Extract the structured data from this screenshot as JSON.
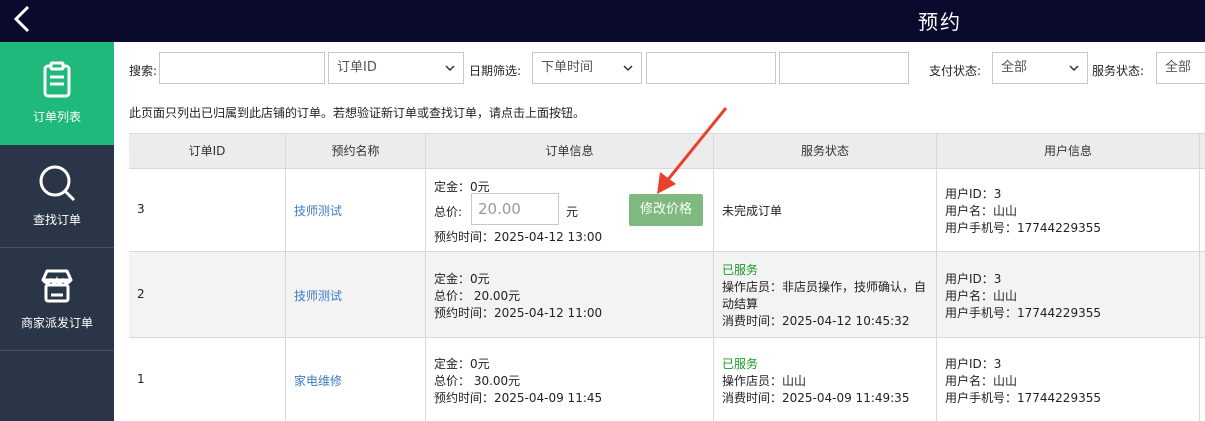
{
  "header": {
    "title": "预约",
    "back_icon": "chevron-left-icon"
  },
  "sidebar": {
    "items": [
      {
        "label": "订单列表",
        "icon": "clipboard-icon",
        "active": true
      },
      {
        "label": "查找订单",
        "icon": "search-icon",
        "active": false
      },
      {
        "label": "商家派发订单",
        "icon": "store-icon",
        "active": false
      }
    ],
    "active_color": "#1fba7b",
    "bg_color": "#2b3548"
  },
  "filters": {
    "search_label": "搜索:",
    "search_value": "",
    "id_select": "订单ID",
    "date_label": "日期筛选:",
    "date_select": "下单时间",
    "date_from": "",
    "date_to": "",
    "pay_label": "支付状态:",
    "pay_select": "全部",
    "service_label": "服务状态:",
    "service_select": "全部"
  },
  "notice": "此页面只列出已归属到此店铺的订单。若想验证新订单或查找订单，请点击上面按钮。",
  "table": {
    "headers": [
      "订单ID",
      "预约名称",
      "订单信息",
      "服务状态",
      "用户信息"
    ],
    "rows": [
      {
        "id": "3",
        "name": "技师测试",
        "deposit": "定金：0元",
        "total_label": "总价:",
        "total_input": "20.00",
        "total_unit": "元",
        "time": "预约时间：2025-04-12 13:00",
        "modify_button": "修改价格",
        "status": "未完成订单",
        "user_id": "用户ID：3",
        "user_name": "用户名：山山",
        "user_phone": "用户手机号：17744229355"
      },
      {
        "id": "2",
        "name": "技师测试",
        "deposit": "定金：0元",
        "total": "总价：  20.00元",
        "time": "预约时间：2025-04-12 11:00",
        "status": "已服务",
        "operator": "操作店员：非店员操作，技师确认，自",
        "operator_cont": "动结算",
        "consume_time": "消费时间：2025-04-12 10:45:32",
        "user_id": "用户ID：3",
        "user_name": "用户名：山山",
        "user_phone": "用户手机号：17744229355"
      },
      {
        "id": "1",
        "name": "家电维修",
        "deposit": "定金：0元",
        "total": "总价：  30.00元",
        "time": "预约时间：2025-04-09 11:45",
        "status": "已服务",
        "operator": "操作店员：山山",
        "consume_time": "消费时间：2025-04-09 11:49:35",
        "user_id": "用户ID：3",
        "user_name": "用户名：山山",
        "user_phone": "用户手机号：17744229355"
      }
    ]
  },
  "colors": {
    "topbar": "#0a0a2e",
    "link": "#3b7cc4",
    "served": "#1a9a2a",
    "modify_button": "#7fb97f",
    "arrow": "#e8412c"
  }
}
